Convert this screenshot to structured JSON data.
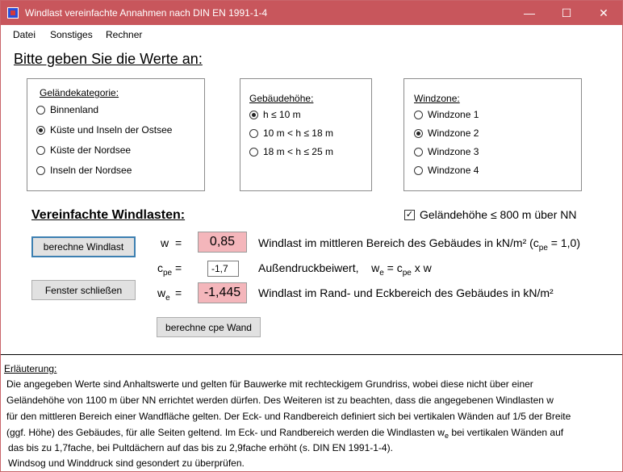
{
  "window": {
    "title": "Windlast vereinfachte Annahmen nach DIN EN 1991-1-4",
    "minimize_glyph": "—",
    "maximize_glyph": "☐",
    "close_glyph": "✕"
  },
  "menu": {
    "items": [
      "Datei",
      "Sonstiges",
      "Rechner"
    ]
  },
  "heading": "Bitte geben Sie die Werte an:",
  "gelaendekategorie": {
    "title": "Geländekategorie:",
    "selected": 1,
    "options": [
      "Binnenland",
      "Küste und Inseln der Ostsee",
      "Küste der Nordsee",
      "Inseln der Nordsee"
    ]
  },
  "gebaeudehoehe": {
    "title": "Gebäudehöhe:",
    "selected": 0,
    "options": [
      "h  ≤ 10 m",
      "10 m < h ≤  18 m",
      "18 m < h ≤  25 m"
    ]
  },
  "windzone": {
    "title": "Windzone:",
    "selected": 1,
    "options": [
      "Windzone 1",
      "Windzone 2",
      "Windzone 3",
      "Windzone 4"
    ]
  },
  "windlasten": {
    "title": "Vereinfachte Windlasten:",
    "gelaende_checkbox": {
      "label": "Geländehöhe ≤ 800 m über NN",
      "checked": true,
      "mark": "✓"
    },
    "berechne_button": "berechne Windlast",
    "schliessen_button": "Fenster schließen",
    "cpe_wand_button": "berechne cpe Wand",
    "w": {
      "symbol": "w",
      "eq": "=",
      "value": "0,85",
      "desc_pre": "Windlast im mittleren Bereich des Gebäudes in kN/m² (c",
      "desc_sub": "pe",
      "desc_post": " = 1,0)"
    },
    "cpe": {
      "symbol": "c",
      "symbol_sub": "pe",
      "eq": "=",
      "value": "-1,7",
      "desc_a": "Außendruckbeiwert,",
      "desc_w": "w",
      "desc_w_sub": "e",
      "desc_eq": " = c",
      "desc_c_sub": "pe",
      "desc_tail": " x  w"
    },
    "we": {
      "symbol": "w",
      "symbol_sub": "e",
      "eq": "=",
      "value": "-1,445",
      "desc": "Windlast im Rand- und Eckbereich des Gebäudes in kN/m²"
    }
  },
  "erlaeuterung": {
    "title": "Erläuterung:",
    "line1": "Die angegeben Werte sind Anhaltswerte und gelten für Bauwerke mit rechteckigem Grundriss, wobei diese nicht über einer",
    "line2": "Geländehöhe von 1100 m über NN errichtet werden dürfen. Des Weiteren ist zu beachten, dass die angegebenen Windlasten w",
    "line3": "für den mittleren Bereich einer Wandfläche gelten. Der Eck- und Randbereich definiert sich bei vertikalen Wänden auf 1/5 der Breite",
    "line4_pre": "(ggf. Höhe) des Gebäudes, für alle Seiten geltend. Im Eck- und Randbereich werden die Windlasten w",
    "line4_sub": "e",
    "line4_post": " bei vertikalen Wänden auf",
    "line5": "das bis zu 1,7fache, bei Pultdächern auf das bis zu 2,9fache erhöht (s. DIN EN 1991-1-4).",
    "line6": "Windsog und Winddruck sind gesondert zu überprüfen."
  }
}
